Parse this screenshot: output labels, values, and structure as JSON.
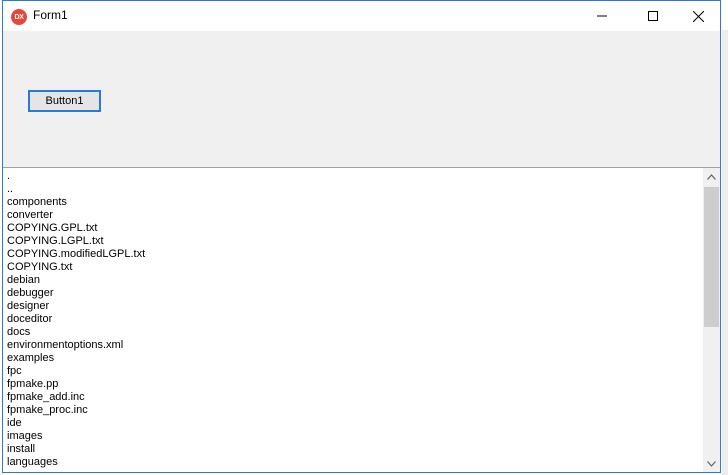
{
  "window": {
    "title": "Form1",
    "icon": "dx-app-icon",
    "accent": "#2b79d6"
  },
  "caption_buttons": [
    "minimize-icon",
    "maximize-icon",
    "close-icon"
  ],
  "form": {
    "button1_label": "Button1"
  },
  "listbox": {
    "items": [
      ".",
      "..",
      "components",
      "converter",
      "COPYING.GPL.txt",
      "COPYING.LGPL.txt",
      "COPYING.modifiedLGPL.txt",
      "COPYING.txt",
      "debian",
      "debugger",
      "designer",
      "doceditor",
      "docs",
      "environmentoptions.xml",
      "examples",
      "fpc",
      "fpmake.pp",
      "fpmake_add.inc",
      "fpmake_proc.inc",
      "ide",
      "images",
      "install",
      "languages"
    ]
  }
}
